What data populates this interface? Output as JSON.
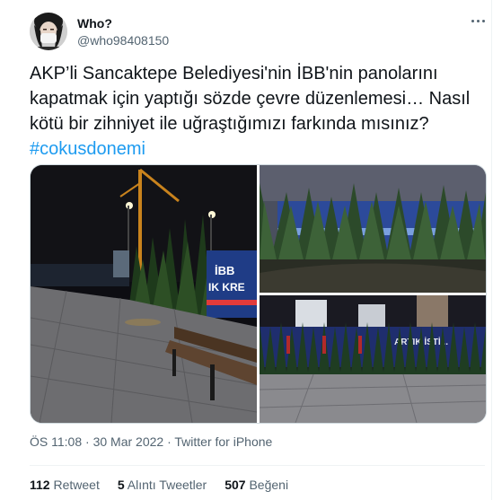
{
  "author": {
    "display_name": "Who?",
    "handle": "@who98408150",
    "avatar_icon": "masked-person-avatar"
  },
  "tweet": {
    "text_lines": [
      "AKP’li Sancaktepe Belediyesi'nin İBB'nin panolarını",
      "kapatmak için yaptığı sözde çevre düzenlemesi… Nasıl",
      "kötü bir zihniyet ile uğraştığımızı farkında mısınız?"
    ],
    "hashtag": "#cokusdonemi"
  },
  "media": {
    "photo1_sign_line1": "İBB",
    "photo1_sign_line2": "IK KRE",
    "photo3_sign_text": "ARTIK İSTİ..."
  },
  "meta": {
    "time": "ÖS 11:08",
    "separator": "·",
    "date": "30 Mar 2022",
    "source": "Twitter for iPhone"
  },
  "stats": {
    "retweets_count": "112",
    "retweets_label": "Retweet",
    "quotes_count": "5",
    "quotes_label": "Alıntı Tweetler",
    "likes_count": "507",
    "likes_label": "Beğeni"
  },
  "colors": {
    "accent": "#1d9bf0",
    "secondary_text": "#536471",
    "primary_text": "#0f1419",
    "border": "#eff3f4"
  }
}
